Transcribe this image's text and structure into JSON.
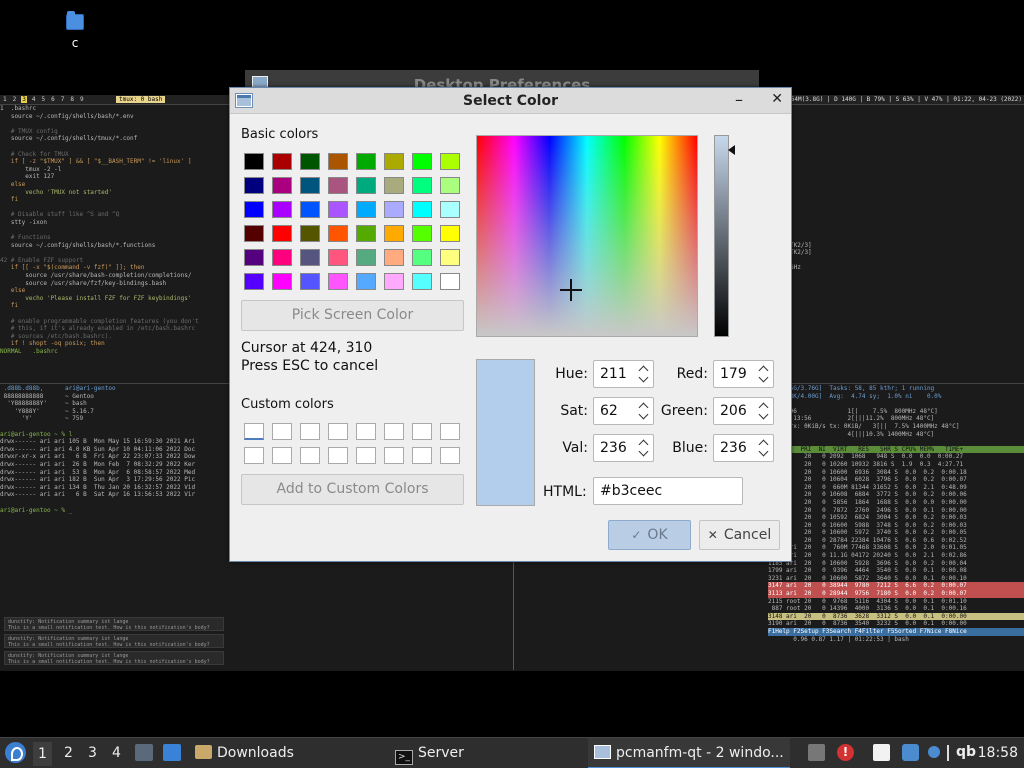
{
  "desktop": {
    "icon_label": "c"
  },
  "tmux": {
    "tabs": [
      "1",
      "2",
      "3",
      "4",
      "5",
      "6",
      "7",
      "8",
      "9"
    ],
    "active_tab": "3",
    "window_name": "tmux: 0 bash",
    "status_right": "M 864M(3.8G) | D 140G | B 79% | S 63% | V 47% | 01:22, 04-23 (2022)"
  },
  "editor": {
    "lines": [
      {
        "t": "1  .bashrc",
        "c": ""
      },
      {
        "t": "   source ~/.config/shells/bash/*.env",
        "c": ""
      },
      {
        "t": "",
        "c": ""
      },
      {
        "t": "   # TMUX config",
        "c": "c-comment"
      },
      {
        "t": "   source ~/.config/shells/tmux/*.conf",
        "c": ""
      },
      {
        "t": "",
        "c": ""
      },
      {
        "t": "   # Check for TMUX",
        "c": "c-comment"
      },
      {
        "t": "   if [ -z \"$TMUX\" ] && [ \"$__BASH_TERM\" != 'linux' ]",
        "c": "c-kw"
      },
      {
        "t": "       tmux -2 -l",
        "c": ""
      },
      {
        "t": "       exit 127",
        "c": ""
      },
      {
        "t": "   else",
        "c": "c-kw"
      },
      {
        "t": "       vecho 'TMUX not started'",
        "c": "c-str"
      },
      {
        "t": "   fi",
        "c": "c-kw"
      },
      {
        "t": "",
        "c": ""
      },
      {
        "t": "   # Disable stuff like ^S and ^Q",
        "c": "c-comment"
      },
      {
        "t": "   stty -ixon",
        "c": ""
      },
      {
        "t": "",
        "c": ""
      },
      {
        "t": "   # Functions",
        "c": "c-comment"
      },
      {
        "t": "   source ~/.config/shells/bash/*.functions",
        "c": ""
      },
      {
        "t": "",
        "c": ""
      },
      {
        "t": "42 # Enable FZF support",
        "c": "c-comment"
      },
      {
        "t": "   if [[ -x \"$(command -v fzf)\" ]]; then",
        "c": "c-kw"
      },
      {
        "t": "       source /usr/share/bash-completion/completions/",
        "c": ""
      },
      {
        "t": "       source /usr/share/fzf/key-bindings.bash",
        "c": ""
      },
      {
        "t": "   else",
        "c": "c-kw"
      },
      {
        "t": "       vecho 'Please install FZF for FZF keybindings'",
        "c": "c-str"
      },
      {
        "t": "   fi",
        "c": "c-kw"
      },
      {
        "t": "",
        "c": ""
      },
      {
        "t": "   # enable programmable completion features (you don't",
        "c": "c-comment"
      },
      {
        "t": "   # this, if it's already enabled in /etc/bash.bashrc",
        "c": "c-comment"
      },
      {
        "t": "   # sources /etc/bash.bashrc).",
        "c": "c-comment"
      },
      {
        "t": "   if ! shopt -oq posix; then",
        "c": "c-kw"
      },
      {
        "t": "NORMAL   .bashrc",
        "c": "c-green"
      }
    ]
  },
  "neofetch": {
    "lines": [
      {
        "t": " .d88b.d88b,      ari@ari-gentoo",
        "c": "c-blue"
      },
      {
        "t": " 88888888888      ~ Gentoo",
        "c": ""
      },
      {
        "t": "  'Y8888888Y'     ~ bash",
        "c": ""
      },
      {
        "t": "    'Y888Y'       ~ 5.16.7",
        "c": ""
      },
      {
        "t": "      'Y'         ~ 759",
        "c": ""
      },
      {
        "t": "",
        "c": ""
      },
      {
        "t": "ari@ari-gentoo ~ % l",
        "c": "c-green"
      },
      {
        "t": "drwx------ ari ari 105 B  Mon May 15 16:59:30 2021 Ari",
        "c": ""
      },
      {
        "t": "drwx------ ari ari 4.0 KB Sun Apr 10 04:11:06 2022 Doc",
        "c": ""
      },
      {
        "t": "drwxr-xr-x ari ari   6 B  Fri Apr 22 23:07:33 2022 Dow",
        "c": ""
      },
      {
        "t": "drwx------ ari ari  26 B  Mon Feb  7 08:32:29 2022 Ker",
        "c": ""
      },
      {
        "t": "drwx------ ari ari  53 B  Mon Apr  6 08:58:57 2022 Med",
        "c": ""
      },
      {
        "t": "drwx------ ari ari 182 B  Sun Apr  3 17:29:56 2022 Pic",
        "c": ""
      },
      {
        "t": "drwx------ ari ari 134 B  Thu Jan 20 16:32:57 2022 Vid",
        "c": ""
      },
      {
        "t": "drwx------ ari ari   6 B  Sat Apr 16 13:56:53 2022 Vir",
        "c": ""
      },
      {
        "t": "",
        "c": ""
      },
      {
        "t": "ari@ari-gentoo ~ % _",
        "c": "c-green"
      }
    ]
  },
  "notifications": [
    {
      "title": "dunstify: Notification summary ist lange",
      "body": "This is a small notification test. How is this notification's body?"
    },
    {
      "title": "dunstify: Notification summary ist lange",
      "body": "This is a small notification test. How is this notification's body?"
    },
    {
      "title": "dunstify: Notification summary ist lange",
      "body": "This is a small notification test. How is this notification's body?"
    }
  ],
  "rightpane": {
    "lines": [
      {
        "t": "",
        "c": ""
      },
      {
        "t": "",
        "c": ""
      },
      {
        "t": "",
        "c": ""
      },
      {
        "t": "",
        "c": ""
      },
      {
        "t": "",
        "c": ""
      },
      {
        "t": "",
        "c": ""
      },
      {
        "t": "",
        "c": ""
      },
      {
        "t": "",
        "c": ""
      },
      {
        "t": "",
        "c": ""
      },
      {
        "t": "",
        "c": ""
      },
      {
        "t": "",
        "c": ""
      },
      {
        "t": "",
        "c": ""
      },
      {
        "t": "",
        "c": ""
      },
      {
        "t": "",
        "c": ""
      },
      {
        "t": "",
        "c": ""
      },
      {
        "t": "",
        "c": ""
      },
      {
        "t": "",
        "c": ""
      },
      {
        "t": "",
        "c": ""
      },
      {
        "t": "TK2/3]",
        "c": ""
      },
      {
        "t": "TK2/3]",
        "c": ""
      },
      {
        "t": "",
        "c": ""
      },
      {
        "t": "GHz",
        "c": ""
      }
    ]
  },
  "htop": {
    "lines": [
      {
        "t": "|||1.05G/3.76G]  Tasks: 58, 85 kthr; 1 running",
        "c": "c-blue"
      },
      {
        "t": "      8K/4.00G]  Avg:  4.74 sy;  1.0% ni    0.0%",
        "c": "c-blue"
      },
      {
        "t": "",
        "c": ""
      },
      {
        "t": "ed: 0.96              1[|    7.5%  800MHz 48°C]",
        "c": ""
      },
      {
        "t": "me: 06:13:56          2[|||11.2%  800MHz 48°C]",
        "c": ""
      },
      {
        "t": "work: rx: 0KiB/s tx: 0KiB/   3[||  7.5% 1400MHz 48°C]",
        "c": ""
      },
      {
        "t": "                      4[|||10.3% 1400MHz 48°C]",
        "c": ""
      },
      {
        "t": "",
        "c": ""
      },
      {
        "t": "USER     PRI  NI  VIRT   RES   SHR S CPU% MEM%   TIME+",
        "c": "htop-header"
      },
      {
        "t": " ari      20   0 2092  1068   948 S  0.0  0.0  0:00.27",
        "c": ""
      },
      {
        "t": " ari      20   0 10260 10932 3816 S  1.9  0.3  4:27.71",
        "c": ""
      },
      {
        "t": " ari      20   0 10600  6936  3084 S  0.0  0.2  0:00.18",
        "c": ""
      },
      {
        "t": " ari      20   0 10604  6028  3796 S  0.0  0.2  0:00.07",
        "c": ""
      },
      {
        "t": " ari      20   0  660M 81344 31652 S  0.0  2.1  0:48.09",
        "c": ""
      },
      {
        "t": " ari      20   0 10608  6884  3772 S  0.0  0.2  0:00.06",
        "c": ""
      },
      {
        "t": " root     20   0  5856  1864  1688 S  0.0  0.0  0:00.00",
        "c": ""
      },
      {
        "t": " root     20   0  7872  2760  2496 S  0.0  0.1  0:00.00",
        "c": ""
      },
      {
        "t": " root     20   0 10592  6824  3004 S  0.0  0.2  0:00.03",
        "c": ""
      },
      {
        "t": " ari      20   0 10600  5988  3748 S  0.0  0.2  0:00.03",
        "c": ""
      },
      {
        "t": " ari      20   0 10600  5972  3740 S  0.0  0.2  0:00.05",
        "c": ""
      },
      {
        "t": " ari      20   0 28784 22384 10476 S  0.6  0.6  0:02.52",
        "c": ""
      },
      {
        "t": "1748 ari  20   0  760M 77468 33608 S  0.0  2.0  0:01.05",
        "c": ""
      },
      {
        "t": "1089 ari  20   0 11.1G 04172 20240 S  0.0  2.1  0:02.86",
        "c": ""
      },
      {
        "t": "1185 ari  20   0 10600  5928  3696 S  0.0  0.2  0:00.04",
        "c": ""
      },
      {
        "t": "1799 ari  20   0  9396  4464  3540 S  0.0  0.1  0:00.08",
        "c": ""
      },
      {
        "t": "3231 ari  20   0 10600  5872  3640 S  0.0  0.1  0:00.10",
        "c": ""
      },
      {
        "t": "3147 ari  20   0 38944  9780  7212 S  6.6  0.2  0:00.07",
        "c": "htop-row-red"
      },
      {
        "t": "3113 ari  20   0 28944  9756  7180 S  0.0  0.2  0:00.07",
        "c": "htop-row-red"
      },
      {
        "t": "2115 root 20   0  9768  5116  4304 S  0.0  0.1  0:01.10",
        "c": ""
      },
      {
        "t": " 887 root 20   0 14396  4000  3136 S  0.0  0.1  0:00.16",
        "c": ""
      },
      {
        "t": "3148 ari  20   0  8736  3628  3312 S  0.0  0.1  0:00.00",
        "c": "htop-row-sel"
      },
      {
        "t": "3190 ari  20   0  8736  3540  3232 S  0.0  0.1  0:00.00",
        "c": ""
      },
      {
        "t": "F1Help F2Setup F3Search F4Filter F5Sorted F7Nice F8Nice",
        "c": "htop-foot"
      },
      {
        "t": "       0.96 0.87 1.17 | 01:22:53 | bash",
        "c": ""
      }
    ]
  },
  "bg_dialog": {
    "title": "Desktop Preferences"
  },
  "dialog": {
    "title": "Select Color",
    "basic_colors_label": "Basic colors",
    "basic_colors": [
      "#000000",
      "#aa0000",
      "#005500",
      "#aa5500",
      "#00aa00",
      "#aaaa00",
      "#00ff00",
      "#aaff00",
      "#00007f",
      "#aa007f",
      "#00557f",
      "#aa557f",
      "#00aa7f",
      "#aaaa7f",
      "#00ff7f",
      "#aaff7f",
      "#0000ff",
      "#aa00ff",
      "#0055ff",
      "#aa55ff",
      "#00aaff",
      "#aaaaff",
      "#00ffff",
      "#aaffff",
      "#550000",
      "#ff0000",
      "#555500",
      "#ff5500",
      "#55aa00",
      "#ffaa00",
      "#55ff00",
      "#ffff00",
      "#55007f",
      "#ff007f",
      "#55557f",
      "#ff557f",
      "#55aa7f",
      "#ffaa7f",
      "#55ff7f",
      "#ffff7f",
      "#5500ff",
      "#ff00ff",
      "#5555ff",
      "#ff55ff",
      "#55aaff",
      "#ffaaff",
      "#55ffff",
      "#ffffff"
    ],
    "pick_screen_label": "Pick Screen Color",
    "cursor_text": "Cursor at 424, 310",
    "esc_text": "Press ESC to cancel",
    "custom_colors_label": "Custom colors",
    "custom_cells": 16,
    "add_custom_label": "Add to Custom Colors",
    "current_color": "#b3ceec",
    "fields": {
      "hue_label": "Hue:",
      "hue": "211",
      "sat_label": "Sat:",
      "sat": "62",
      "val_label": "Val:",
      "val": "236",
      "red_label": "Red:",
      "red": "179",
      "green_label": "Green:",
      "green": "206",
      "blue_label": "Blue:",
      "blue": "236"
    },
    "html_label": "HTML:",
    "html_value": "#b3ceec",
    "ok_label": "OK",
    "cancel_label": "Cancel"
  },
  "taskbar": {
    "workspaces": [
      "1",
      "2",
      "3",
      "4"
    ],
    "active_workspace": "1",
    "tasks": {
      "downloads": "Downloads",
      "server": "Server",
      "pcmanfm": "pcmanfm-qt - 2 windo..."
    },
    "tray_qb": "qb",
    "clock": "18:58"
  }
}
